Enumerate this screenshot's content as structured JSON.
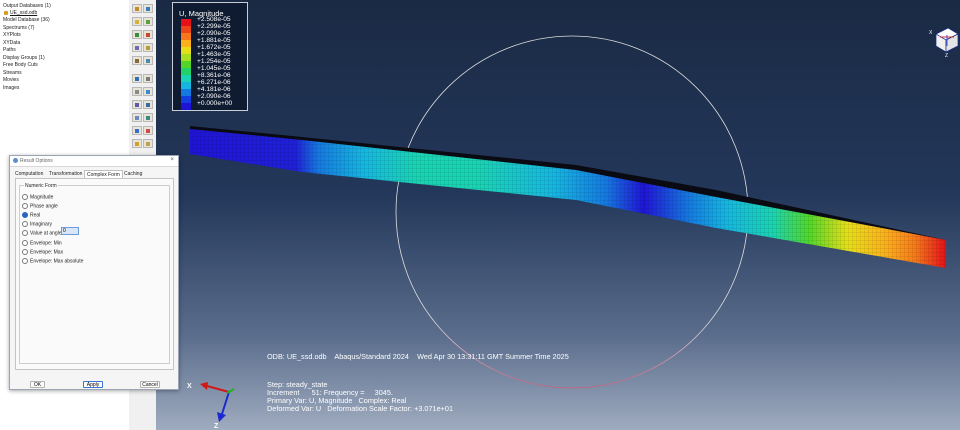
{
  "model_tree": {
    "items": [
      {
        "label": "Output Databases (1)"
      },
      {
        "label": "UE_ssd.odb",
        "selected": true,
        "icon": "odb-icon"
      },
      {
        "label": "Model Database (36)"
      },
      {
        "label": "Spectrums (7)"
      },
      {
        "label": "XYPlots"
      },
      {
        "label": "XYData"
      },
      {
        "label": "Paths"
      },
      {
        "label": "Display Groups (1)"
      },
      {
        "label": "Free Body Cuts"
      },
      {
        "label": "Streams"
      },
      {
        "label": "Movies"
      },
      {
        "label": "Images"
      }
    ]
  },
  "legend": {
    "title": "U, Magnitude",
    "entries": [
      {
        "value": "+2.508e-05",
        "color": "#e5101a"
      },
      {
        "value": "+2.299e-05",
        "color": "#ef4318"
      },
      {
        "value": "+2.090e-05",
        "color": "#f6781a"
      },
      {
        "value": "+1.881e-05",
        "color": "#fbb01c"
      },
      {
        "value": "+1.672e-05",
        "color": "#e6de1a"
      },
      {
        "value": "+1.463e-05",
        "color": "#a6e020"
      },
      {
        "value": "+1.254e-05",
        "color": "#53d628"
      },
      {
        "value": "+1.045e-05",
        "color": "#21d268"
      },
      {
        "value": "+8.361e-06",
        "color": "#1ad3b2"
      },
      {
        "value": "+6.271e-06",
        "color": "#16b6e0"
      },
      {
        "value": "+4.181e-06",
        "color": "#1479e0"
      },
      {
        "value": "+2.090e-06",
        "color": "#143ee0"
      },
      {
        "value": "+0.000e+00",
        "color": "#1f14d6"
      }
    ]
  },
  "viewport_info": {
    "odb_line": "ODB: UE_ssd.odb    Abaqus/Standard 2024    Wed Apr 30 13:31:11 GMT Summer Time 2025",
    "step_line": "Step: steady_state",
    "increment_line": "Increment      51: Frequency =     3045.",
    "primary_line": "Primary Var: U, Magnitude   Complex: Real",
    "deformed_line": "Deformed Var: U   Deformation Scale Factor: +3.071e+01"
  },
  "triad": {
    "x": "X",
    "y": "Y",
    "z": "Z"
  },
  "view_cube": {
    "x_label": "X",
    "z_label": "Z"
  },
  "dialog": {
    "title": "Result Options",
    "tabs": [
      {
        "label": "Computation"
      },
      {
        "label": "Transformation"
      },
      {
        "label": "Complex Form",
        "active": true
      },
      {
        "label": "Caching"
      }
    ],
    "group_title": "Numeric Form",
    "options": [
      {
        "label": "Magnitude",
        "checked": false
      },
      {
        "label": "Phase angle",
        "checked": false
      },
      {
        "label": "Real",
        "checked": true
      },
      {
        "label": "Imaginary",
        "checked": false
      },
      {
        "label": "Value at angle",
        "checked": false
      },
      {
        "label": "Envelope: Min",
        "checked": false
      },
      {
        "label": "Envelope: Max",
        "checked": false
      },
      {
        "label": "Envelope: Max absolute",
        "checked": false
      }
    ],
    "angle_value": "0",
    "buttons": {
      "ok": "OK",
      "apply": "Apply",
      "cancel": "Cancel"
    }
  }
}
